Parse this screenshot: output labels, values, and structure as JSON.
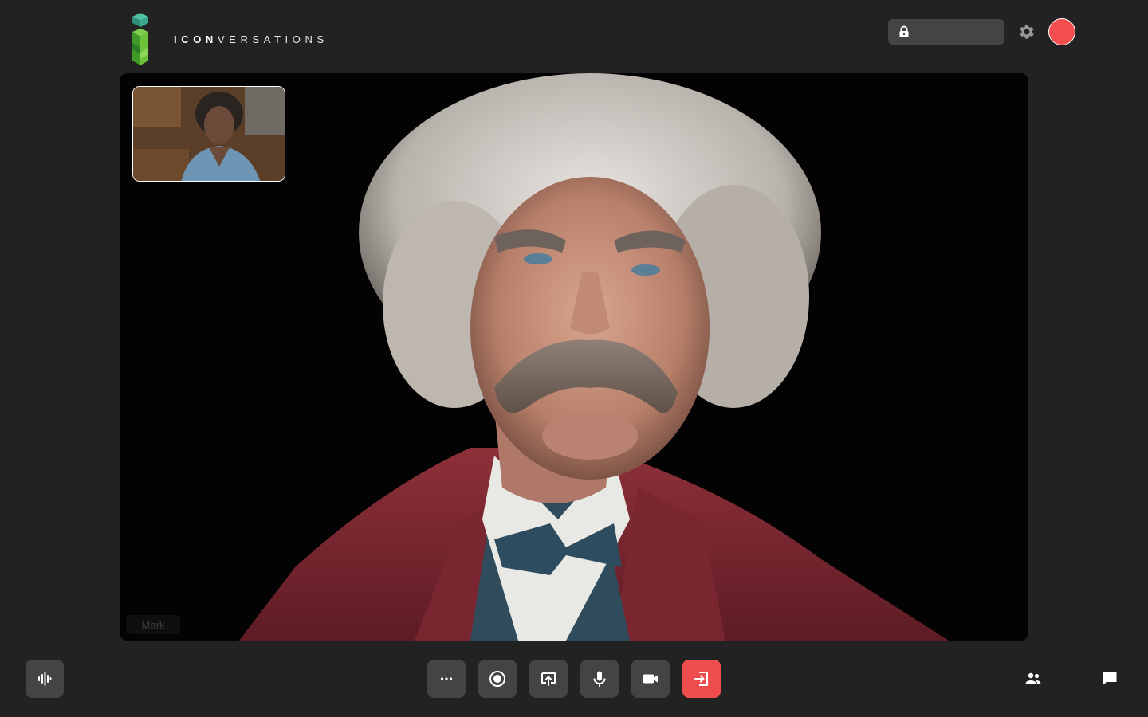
{
  "header": {
    "brand_bold": "ICON",
    "brand_rest": "VERSATIONS",
    "room_code": "",
    "icons": [
      "logo-mark",
      "lock-icon",
      "gear-icon",
      "record-dot-icon"
    ],
    "record_color": "#f24e4e"
  },
  "stage": {
    "participant_name": "Mark",
    "self_view": "self-view-thumbnail"
  },
  "toolbar": {
    "left": {
      "icon": "audio-wave-icon"
    },
    "center": [
      {
        "icon": "more-icon"
      },
      {
        "icon": "record-icon"
      },
      {
        "icon": "share-screen-icon"
      },
      {
        "icon": "microphone-icon"
      },
      {
        "icon": "camera-icon"
      },
      {
        "icon": "leave-icon",
        "color": "#ef4d4d"
      }
    ],
    "right": [
      {
        "icon": "participants-icon"
      },
      {
        "icon": "chat-icon"
      }
    ]
  },
  "colors": {
    "background": "#222222",
    "button": "#444444",
    "accent_red": "#ef4d4d"
  }
}
